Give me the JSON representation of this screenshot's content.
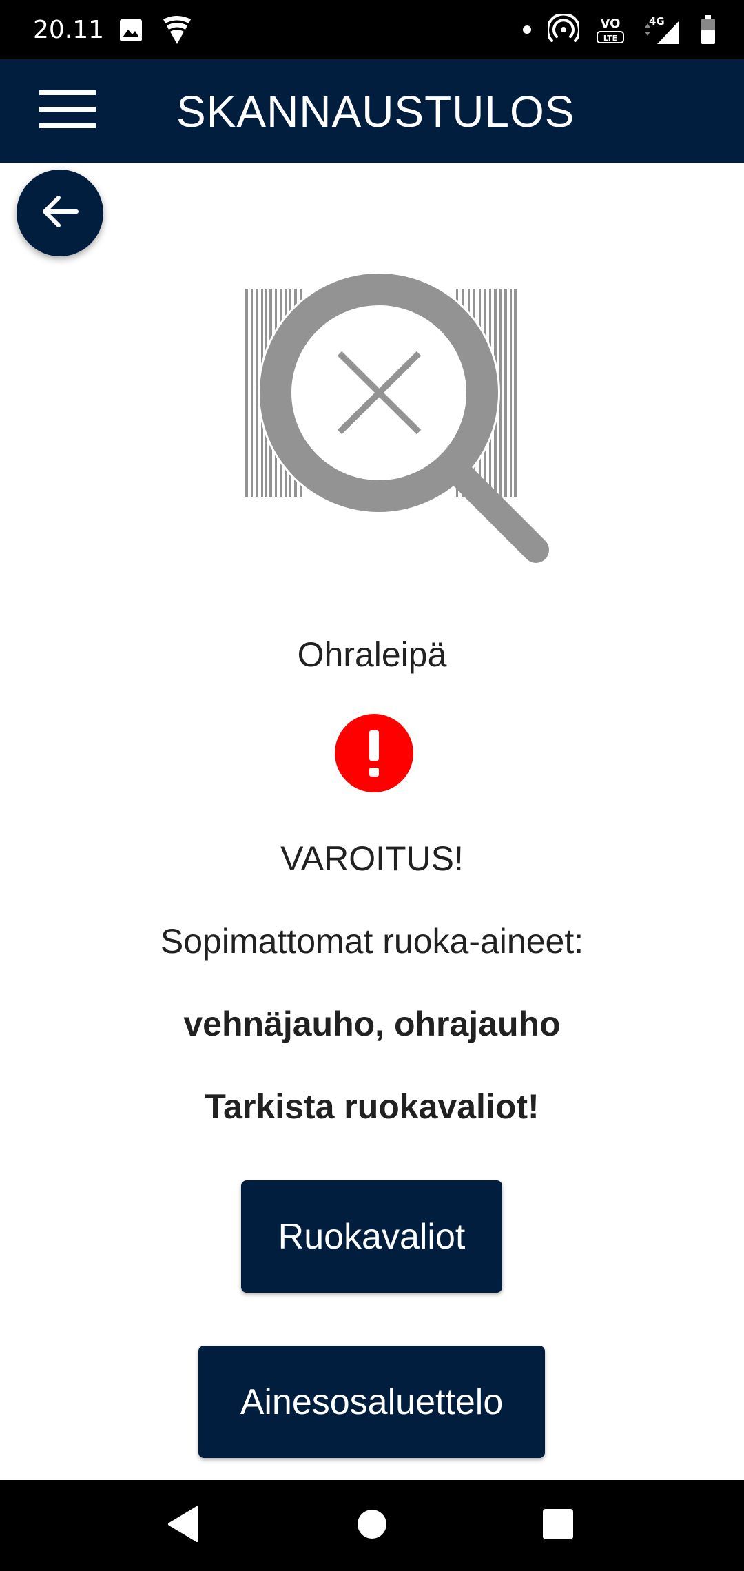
{
  "status_bar": {
    "time": "20.11",
    "icons": [
      "image-icon",
      "shield-signal-icon",
      "notification-dot-icon",
      "hotspot-icon",
      "volte-icon",
      "4g-signal-icon",
      "battery-icon"
    ]
  },
  "app_bar": {
    "title": "SKANNAUSTULOS",
    "menu_icon": "hamburger-menu-icon"
  },
  "back_button": {
    "icon": "arrow-left-icon"
  },
  "illustration": {
    "icon": "barcode-not-found-icon"
  },
  "result": {
    "product_name": "Ohraleipä",
    "warning_icon": "exclamation-circle-icon",
    "warning_title": "VAROITUS!",
    "unsuitable_label": "Sopimattomat ruoka-aineet:",
    "unsuitable_list": "vehnäjauho, ohrajauho",
    "check_note": "Tarkista ruokavaliot!"
  },
  "buttons": {
    "diets_label": "Ruokavaliot",
    "ingredients_label": "Ainesosaluettelo"
  },
  "nav_bar": {
    "icons": [
      "nav-back-icon",
      "nav-home-icon",
      "nav-recents-icon"
    ]
  },
  "colors": {
    "primary": "#021e3e",
    "warning": "#ff0000",
    "illustration_gray": "#939393",
    "text": "#212121"
  }
}
